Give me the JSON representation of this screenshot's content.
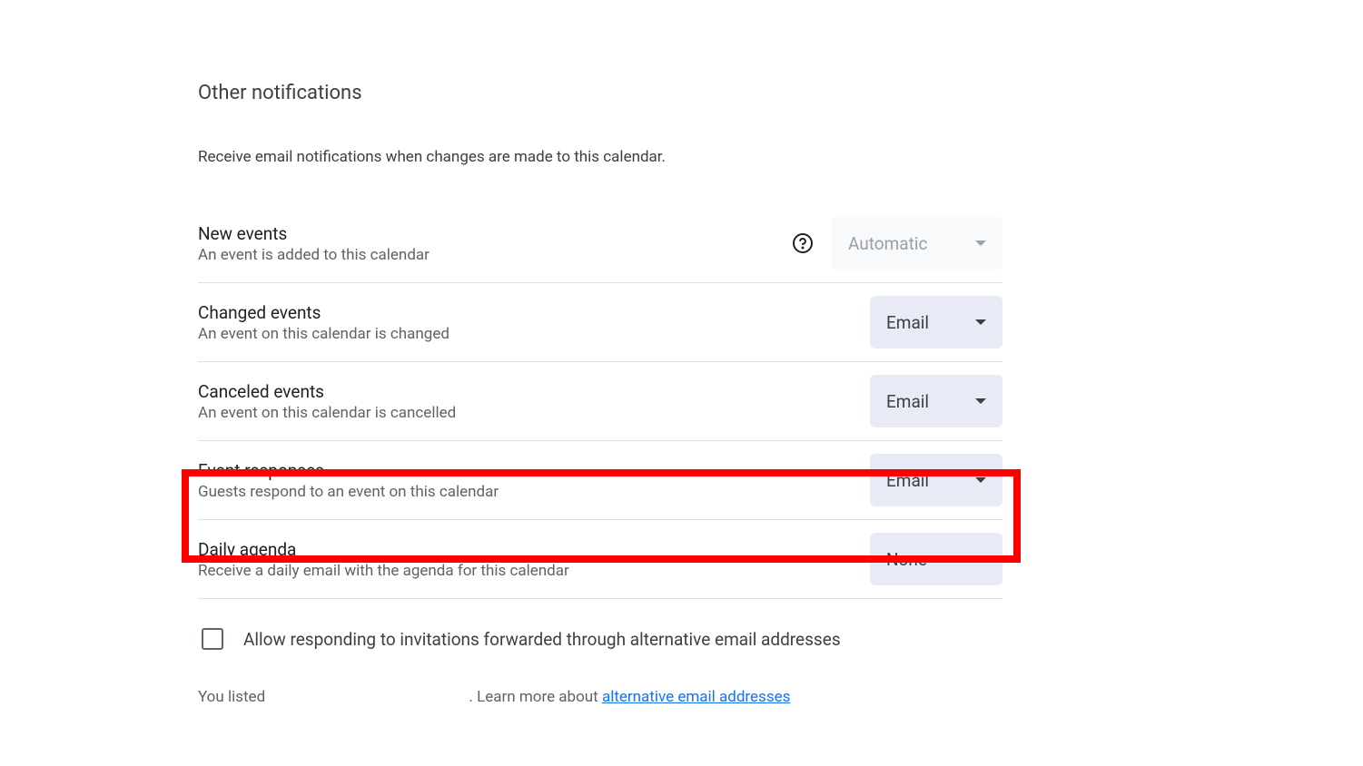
{
  "section": {
    "title": "Other notifications",
    "description": "Receive email notifications when changes are made to this calendar."
  },
  "rows": [
    {
      "title": "New events",
      "desc": "An event is added to this calendar",
      "value": "Automatic",
      "disabled": true,
      "help": true
    },
    {
      "title": "Changed events",
      "desc": "An event on this calendar is changed",
      "value": "Email",
      "disabled": false,
      "help": false
    },
    {
      "title": "Canceled events",
      "desc": "An event on this calendar is cancelled",
      "value": "Email",
      "disabled": false,
      "help": false
    },
    {
      "title": "Event responses",
      "desc": "Guests respond to an event on this calendar",
      "value": "Email",
      "disabled": false,
      "help": false
    },
    {
      "title": "Daily agenda",
      "desc": "Receive a daily email with the agenda for this calendar",
      "value": "None",
      "disabled": false,
      "help": false
    }
  ],
  "checkbox": {
    "label": "Allow responding to invitations forwarded through alternative email addresses"
  },
  "footer": {
    "prefix": "You listed ",
    "middle": ". Learn more about ",
    "link": "alternative email addresses"
  }
}
